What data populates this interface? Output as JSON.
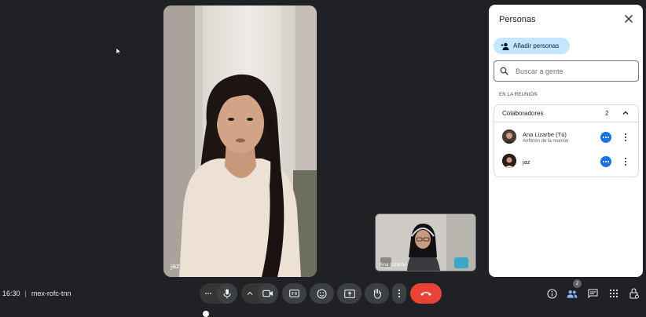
{
  "main_video": {
    "participant_name": "jaz"
  },
  "self_view": {
    "participant_name": "Ana Lizarbe"
  },
  "people_panel": {
    "title": "Personas",
    "add_people_label": "Añadir personas",
    "search": {
      "placeholder": "Buscar a gente",
      "value": ""
    },
    "section_label": "EN LA REUNIÓN",
    "group": {
      "title": "Colaboradores",
      "count": "2",
      "members": [
        {
          "name": "Ana Lizarbe (Tú)",
          "role": "Anfitrión de la reunión"
        },
        {
          "name": "jaz",
          "role": ""
        }
      ]
    }
  },
  "bottom_bar": {
    "time": "16:30",
    "separator": "|",
    "meeting_code": "mex-rofc-tnn",
    "people_badge": "2"
  },
  "colors": {
    "hangup": "#ea4335",
    "accent_blue": "#1a73e8",
    "add_button_bg": "#c2e7ff"
  }
}
